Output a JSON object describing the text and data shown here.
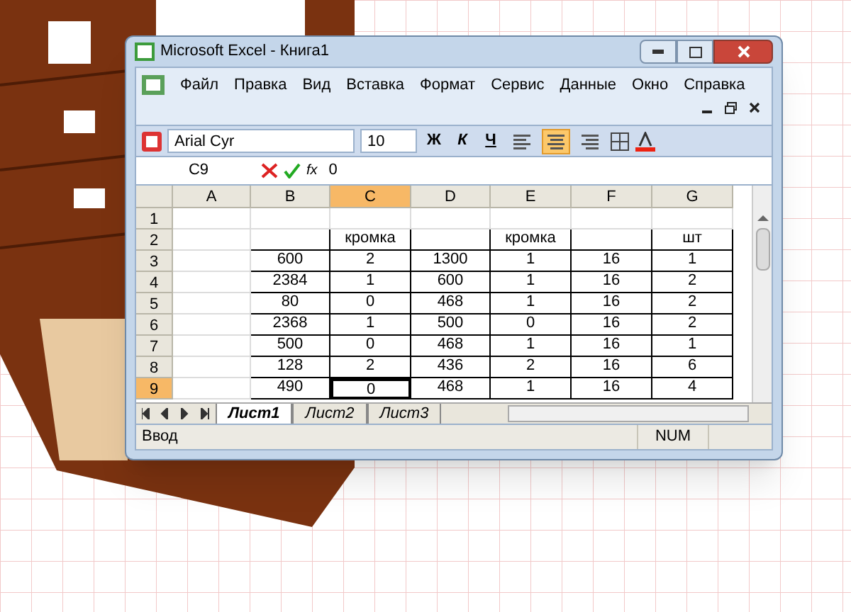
{
  "window": {
    "title": "Microsoft Excel - Книга1"
  },
  "menu": [
    "Файл",
    "Правка",
    "Вид",
    "Вставка",
    "Формат",
    "Сервис",
    "Данные",
    "Окно",
    "Справка"
  ],
  "toolbar": {
    "font": "Arial Cyr",
    "size": "10",
    "bold": "Ж",
    "italic": "К",
    "underline": "Ч",
    "align": [
      {
        "kind": "left",
        "selected": false
      },
      {
        "kind": "center",
        "selected": true
      },
      {
        "kind": "right",
        "selected": false
      }
    ]
  },
  "formula_bar": {
    "name_box": "C9",
    "fx": "fx",
    "value": "0"
  },
  "sheet": {
    "columns": [
      {
        "label": "A",
        "selected": false
      },
      {
        "label": "B",
        "selected": false
      },
      {
        "label": "C",
        "selected": true
      },
      {
        "label": "D",
        "selected": false
      },
      {
        "label": "E",
        "selected": false
      },
      {
        "label": "F",
        "selected": false
      },
      {
        "label": "G",
        "selected": false
      }
    ],
    "rows": [
      {
        "label": "1",
        "selected": false,
        "cells": [
          null,
          null,
          null,
          null,
          null,
          null,
          null
        ]
      },
      {
        "label": "2",
        "selected": false,
        "cells": [
          null,
          null,
          "кромка",
          null,
          "кромка",
          null,
          "шт"
        ]
      },
      {
        "label": "3",
        "selected": false,
        "cells": [
          null,
          "600",
          "2",
          "1300",
          "1",
          "16",
          "1"
        ]
      },
      {
        "label": "4",
        "selected": false,
        "cells": [
          null,
          "2384",
          "1",
          "600",
          "1",
          "16",
          "2"
        ]
      },
      {
        "label": "5",
        "selected": false,
        "cells": [
          null,
          "80",
          "0",
          "468",
          "1",
          "16",
          "2"
        ]
      },
      {
        "label": "6",
        "selected": false,
        "cells": [
          null,
          "2368",
          "1",
          "500",
          "0",
          "16",
          "2"
        ]
      },
      {
        "label": "7",
        "selected": false,
        "cells": [
          null,
          "500",
          "0",
          "468",
          "1",
          "16",
          "1"
        ]
      },
      {
        "label": "8",
        "selected": false,
        "cells": [
          null,
          "128",
          "2",
          "436",
          "2",
          "16",
          "6"
        ]
      },
      {
        "label": "9",
        "selected": true,
        "cells": [
          null,
          "490",
          "0",
          "468",
          "1",
          "16",
          "4"
        ]
      }
    ]
  },
  "tabs": [
    {
      "label": "Лист1",
      "selected": true
    },
    {
      "label": "Лист2",
      "selected": false
    },
    {
      "label": "Лист3",
      "selected": false
    }
  ],
  "status_bar": {
    "mode": "Ввод",
    "indicators": [
      "NUM"
    ]
  }
}
